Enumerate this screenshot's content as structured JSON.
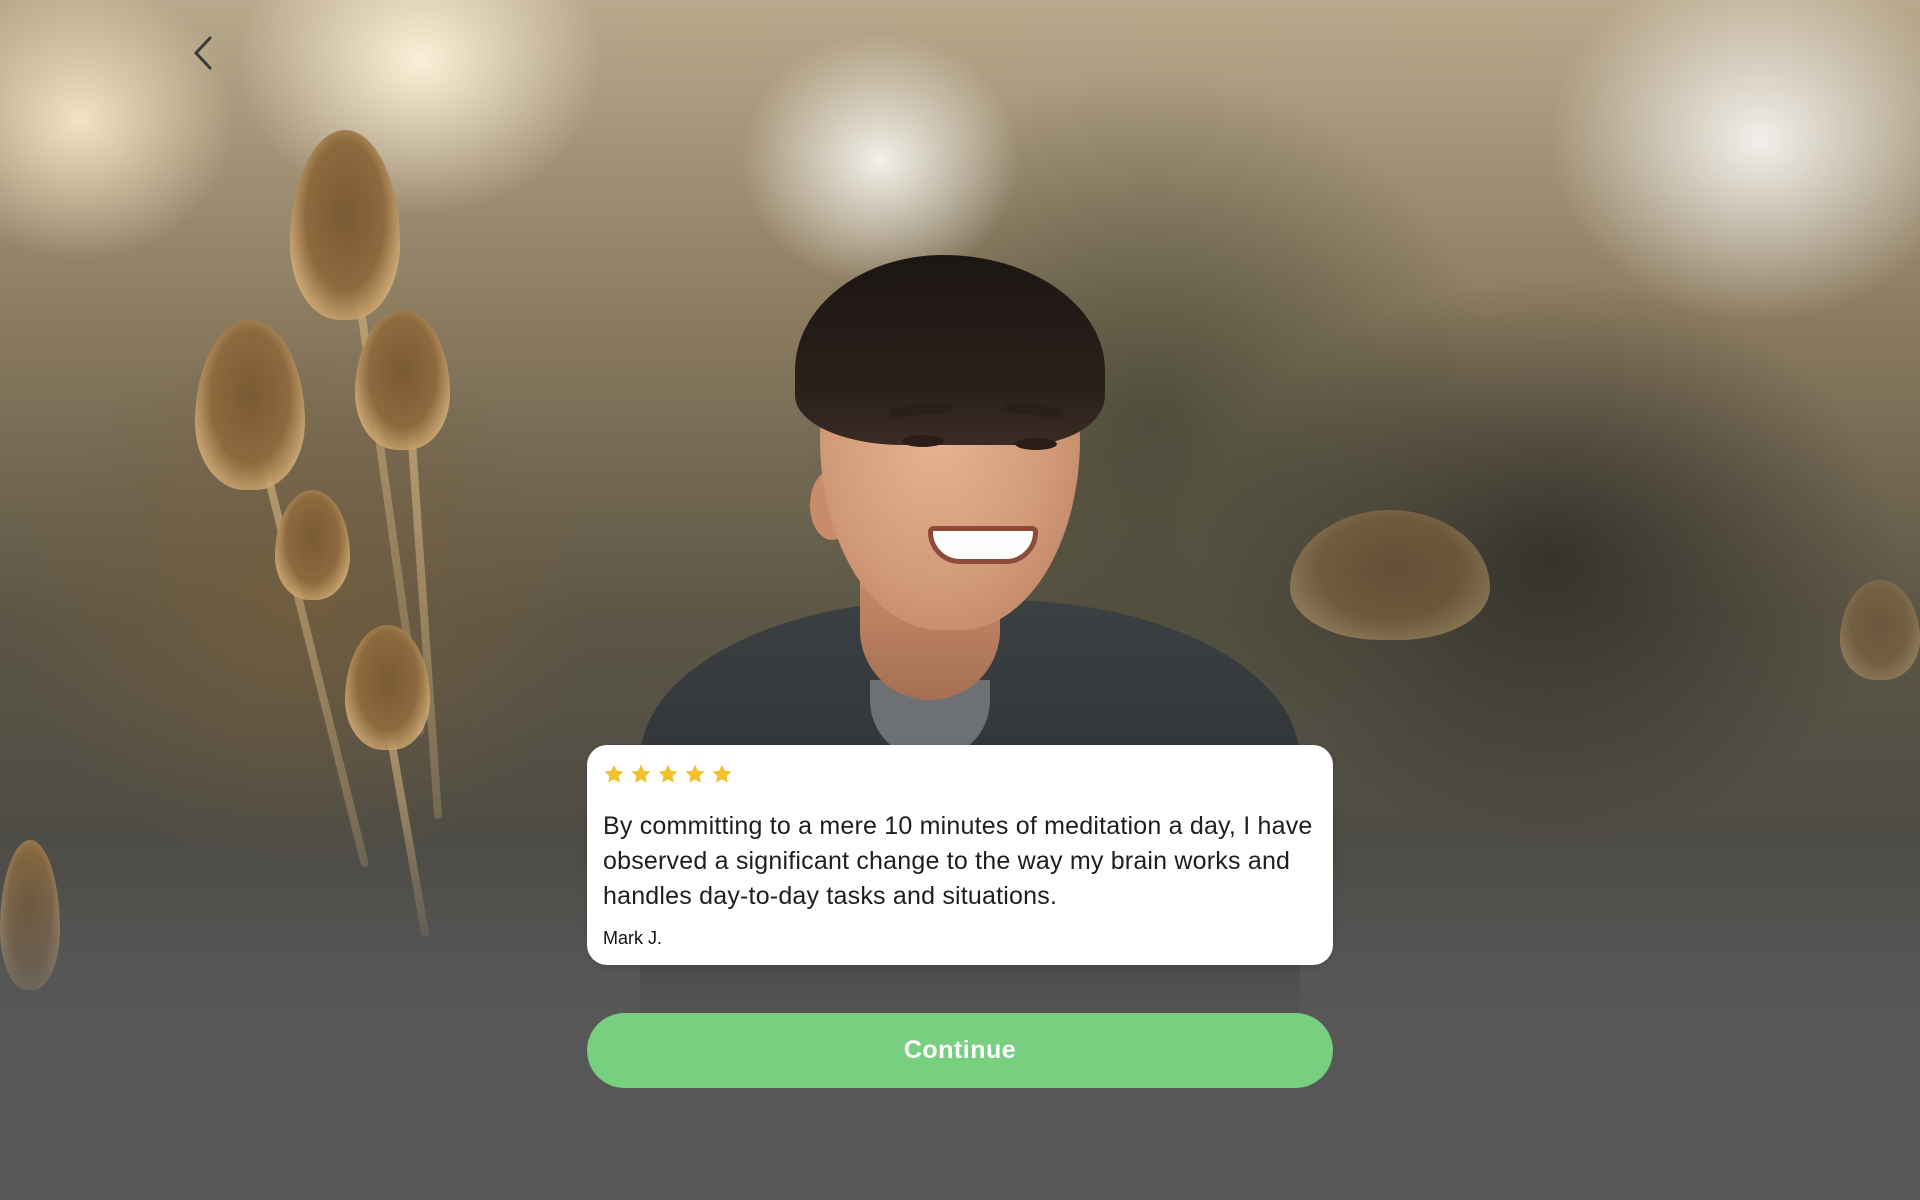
{
  "background": {
    "description_icon": "photo-background",
    "bottom_color": "#575757"
  },
  "navigation": {
    "back_icon": "chevron-left-icon"
  },
  "review": {
    "rating": 5,
    "rating_max": 5,
    "star_color": "#f2c12e",
    "text": "By committing to a mere 10 minutes of meditation a day, I have observed a significant change to the way my brain works and handles day-to-day tasks and situations.",
    "author": "Mark J."
  },
  "actions": {
    "continue_label": "Continue",
    "continue_color": "#78cf80"
  }
}
